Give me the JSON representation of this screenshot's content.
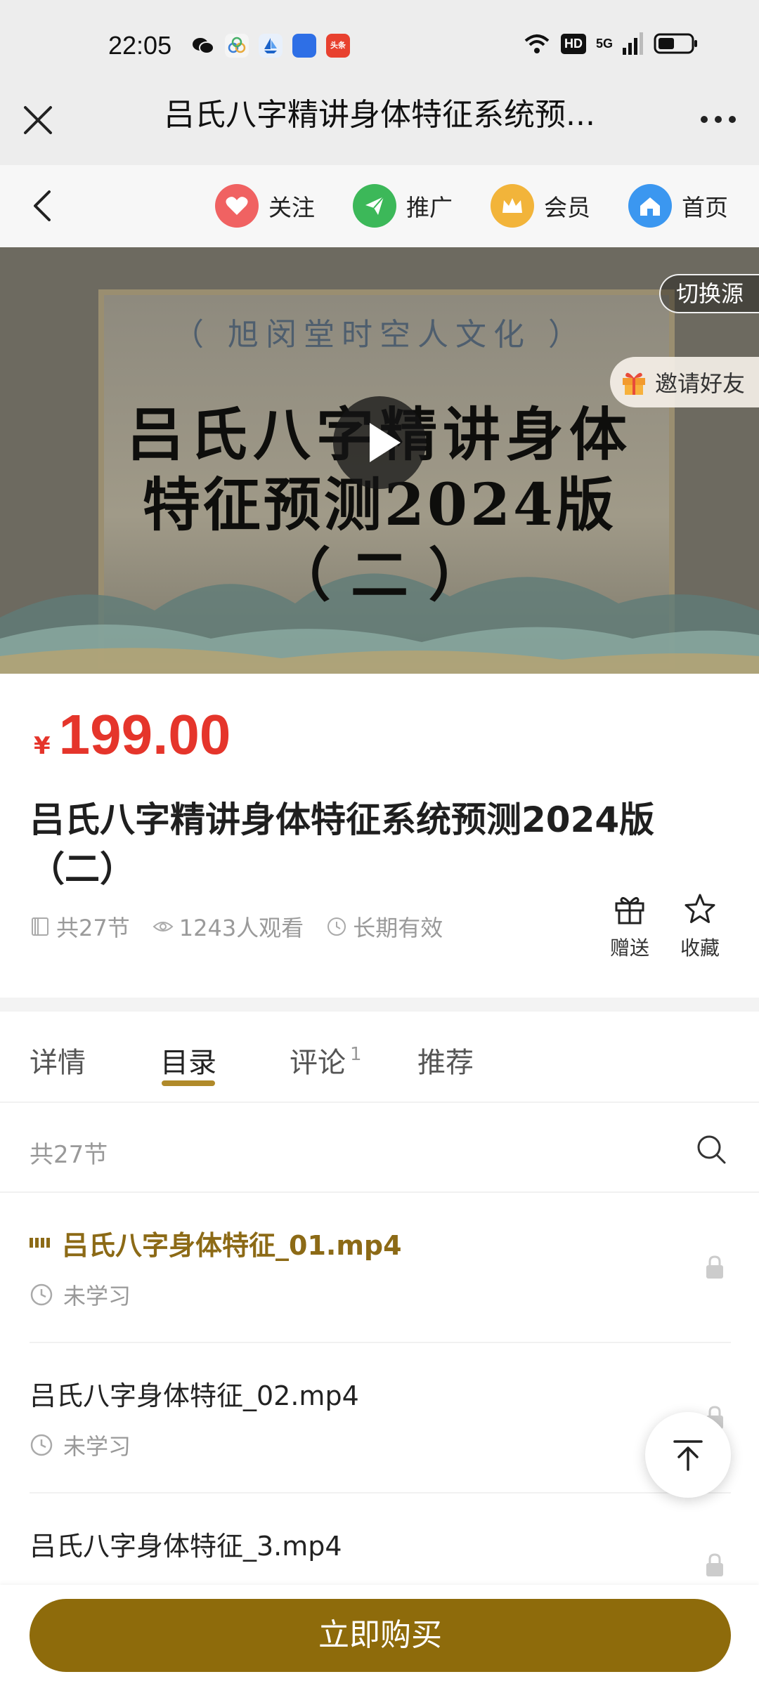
{
  "status_bar": {
    "time": "22:05",
    "app_icons": [
      "wechat-icon",
      "cloud-app-icon",
      "sailboat-app-icon",
      "blue-app-icon",
      "toutiao-icon"
    ],
    "toutiao_label": "头条",
    "hd_label": "HD",
    "network_label": "5G"
  },
  "titlebar": {
    "title": "吕氏八字精讲身体特征系统预..."
  },
  "shop_nav": {
    "items": [
      {
        "label": "关注",
        "icon": "heart-icon",
        "color": "#f06262"
      },
      {
        "label": "推广",
        "icon": "send-icon",
        "color": "#3cb859"
      },
      {
        "label": "会员",
        "icon": "crown-icon",
        "color": "#f2b43a"
      },
      {
        "label": "首页",
        "icon": "home-icon",
        "color": "#3b97f0"
      }
    ]
  },
  "video": {
    "subtitle": "（ 旭闵堂时空人文化 ）",
    "line1": "吕氏八字精讲身体",
    "line2": "特征预测2024版",
    "line3": "（ 二 ）",
    "switch_source": "切换源",
    "invite": "邀请好友"
  },
  "price": {
    "symbol": "¥",
    "value": "199.00"
  },
  "course": {
    "title": "吕氏八字精讲身体特征系统预测2024版（二）",
    "lessons_meta": "共27节",
    "views_meta": "1243人观看",
    "validity_meta": "长期有效",
    "gift_label": "赠送",
    "favorite_label": "收藏"
  },
  "tabs": [
    {
      "label": "详情"
    },
    {
      "label": "目录",
      "active": true
    },
    {
      "label": "评论",
      "count": "1"
    },
    {
      "label": "推荐"
    }
  ],
  "catalog": {
    "count_label": "共27节",
    "lessons": [
      {
        "title": "吕氏八字身体特征_01.mp4",
        "status": "未学习",
        "active": true
      },
      {
        "title": "吕氏八字身体特征_02.mp4",
        "status": "未学习",
        "active": false
      },
      {
        "title": "吕氏八字身体特征_3.mp4",
        "status": "",
        "active": false
      }
    ]
  },
  "buy_button": "立即购买",
  "colors": {
    "price_red": "#e5352b",
    "accent_gold": "#8e6b0b",
    "active_lesson": "#8c6a16"
  }
}
